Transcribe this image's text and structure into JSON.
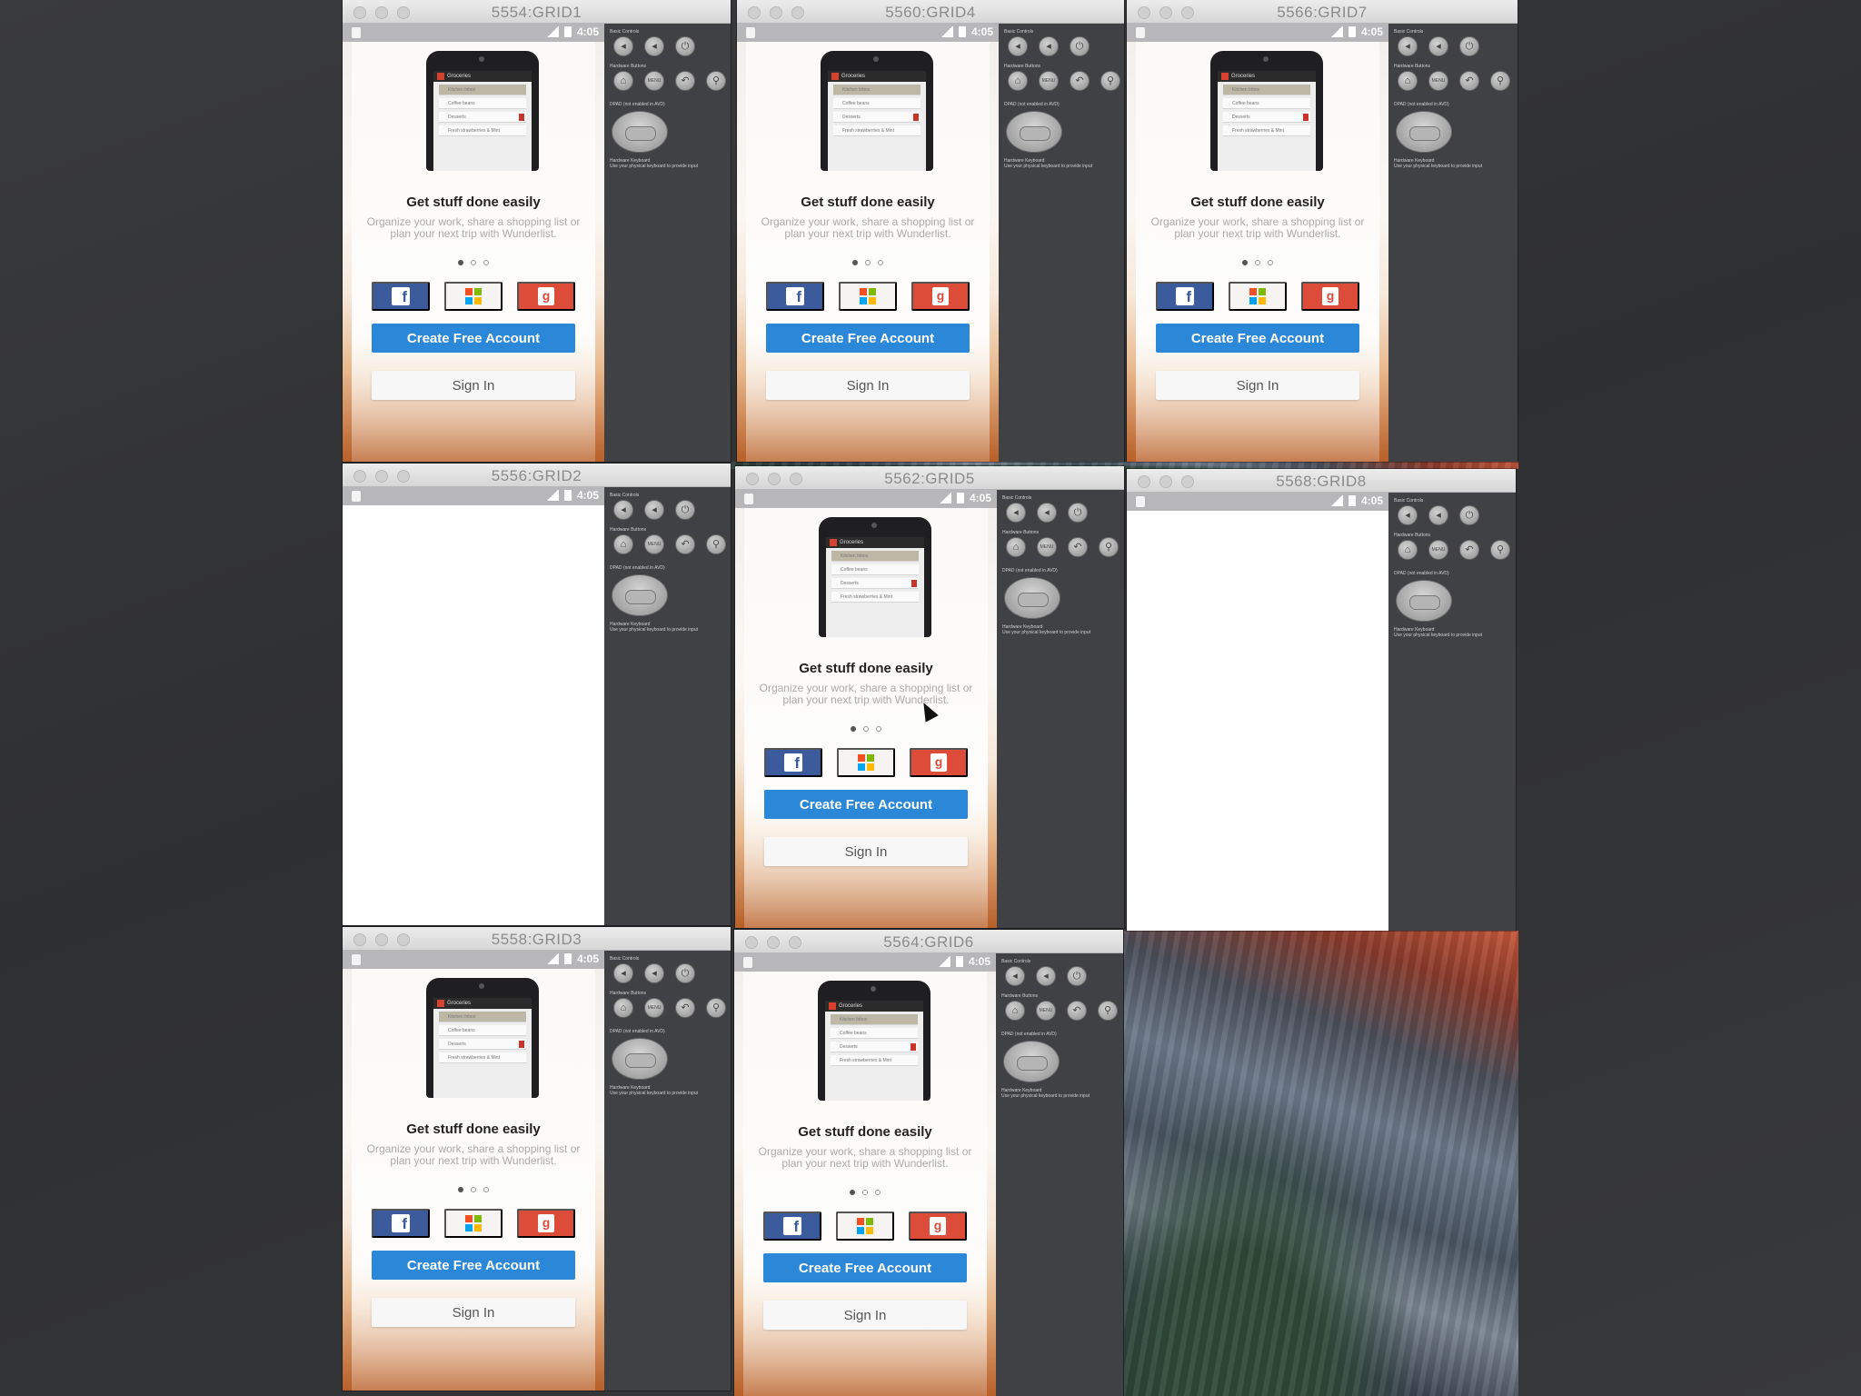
{
  "app": {
    "headline": "Get stuff done easily",
    "description": "Organize your work, share a shopping list or plan your next trip with Wunderlist.",
    "create_label": "Create Free Account",
    "signin_label": "Sign In",
    "mock_phone": {
      "bar_title": "Groceries",
      "rows": [
        "Kitchen Inbox",
        "Coffee beans",
        "Desserts",
        "Fresh strawberries & Mint"
      ]
    },
    "page_dots": {
      "count": 3,
      "active": 0
    },
    "social_icons": [
      "facebook-icon",
      "microsoft-icon",
      "google-icon"
    ],
    "colors": {
      "facebook": "#3b5b9c",
      "google": "#dd4b39",
      "create": "#2b88d9"
    }
  },
  "status": {
    "time": "4:05"
  },
  "panel": {
    "basic_controls": "Basic Controls",
    "hardware_buttons": "Hardware Buttons",
    "dpad": "DPAD (not enabled in AVD)",
    "keyboard": "Hardware Keyboard",
    "keyboard_hint": "Use your physical keyboard to provide input",
    "menu_label": "MENU"
  },
  "windows": [
    {
      "id": "w1",
      "title": "5554:GRID1",
      "blank": false
    },
    {
      "id": "w4",
      "title": "5560:GRID4",
      "blank": false
    },
    {
      "id": "w7",
      "title": "5566:GRID7",
      "blank": false
    },
    {
      "id": "w2",
      "title": "5556:GRID2",
      "blank": true
    },
    {
      "id": "w5",
      "title": "5562:GRID5",
      "blank": false
    },
    {
      "id": "w8",
      "title": "5568:GRID8",
      "blank": true
    },
    {
      "id": "w3",
      "title": "5558:GRID3",
      "blank": false
    },
    {
      "id": "w6",
      "title": "5564:GRID6",
      "blank": false
    }
  ]
}
